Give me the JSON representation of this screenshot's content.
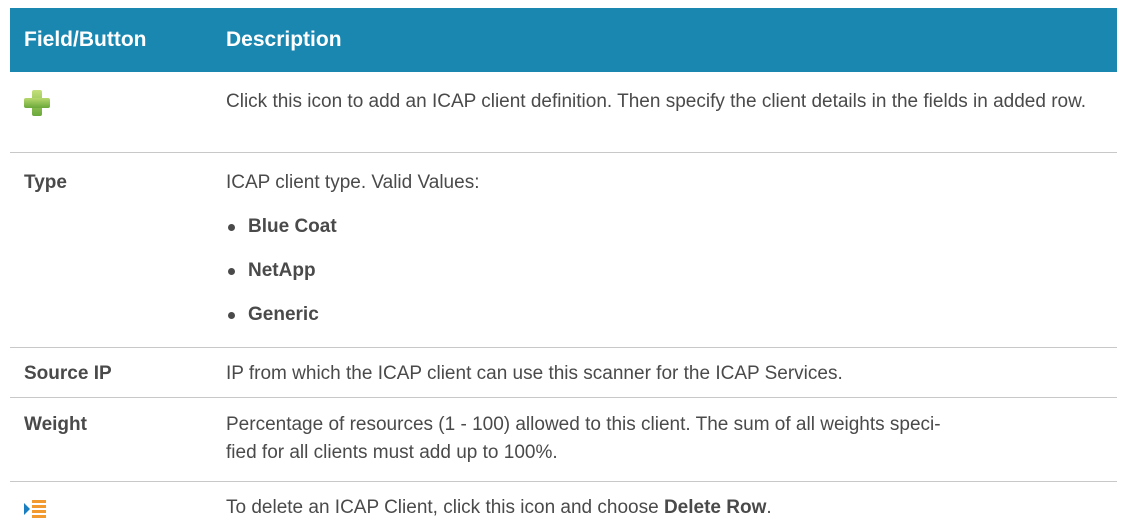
{
  "header": {
    "col1": "Field/Button",
    "col2": "Description"
  },
  "rows": {
    "add": {
      "icon": "add-plus-icon",
      "description": "Click this icon to add an ICAP client definition. Then specify the client details in the fields in added row."
    },
    "type": {
      "field": "Type",
      "intro": "ICAP client type. Valid Values:",
      "values": [
        "Blue Coat",
        "NetApp",
        "Generic"
      ]
    },
    "source_ip": {
      "field": "Source IP",
      "description": "IP from which the ICAP client can use this scanner for the ICAP Services."
    },
    "weight": {
      "field": "Weight",
      "description_line1": "Percentage of resources (1 - 100) allowed to this client. The sum of all weights speci-",
      "description_line2": "fied for all clients must add up to 100%."
    },
    "delete": {
      "icon": "row-menu-icon",
      "description_prefix": "To delete an ICAP Client, click this icon and choose ",
      "description_bold": "Delete Row",
      "description_suffix": "."
    }
  },
  "colors": {
    "header_bg": "#1a87b0",
    "header_text": "#ffffff",
    "body_text": "#4a4a4a",
    "row_divider": "#c8c8c8"
  }
}
